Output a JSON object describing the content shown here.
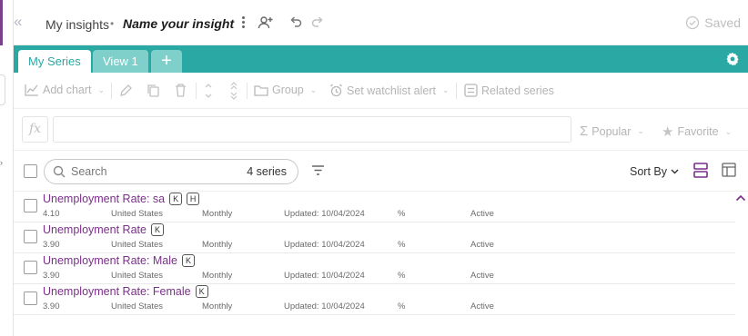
{
  "header": {
    "breadcrumb": "My insights",
    "separator": "•",
    "insight_name": "Name your insight",
    "saved_label": "Saved"
  },
  "tabs": [
    {
      "label": "My Series",
      "active": true
    },
    {
      "label": "View 1",
      "active": false
    },
    {
      "label": "+",
      "active": false
    }
  ],
  "toolbar": {
    "add_chart": "Add chart",
    "group": "Group",
    "watchlist": "Set watchlist alert",
    "related": "Related series"
  },
  "formula": {
    "fx": "fx",
    "popular": "Popular",
    "favorite": "Favorite"
  },
  "search": {
    "placeholder": "Search",
    "count": "4 series",
    "sort_label": "Sort By"
  },
  "series": [
    {
      "title": "Unemployment Rate: sa",
      "tags": [
        "K",
        "H"
      ],
      "value": "4.10",
      "geo": "United States",
      "frequency": "Monthly",
      "updated": "Updated: 10/04/2024",
      "unit": "%",
      "status": "Active"
    },
    {
      "title": "Unemployment Rate",
      "tags": [
        "K"
      ],
      "value": "3.90",
      "geo": "United States",
      "frequency": "Monthly",
      "updated": "Updated: 10/04/2024",
      "unit": "%",
      "status": "Active"
    },
    {
      "title": "Unemployment Rate: Male",
      "tags": [
        "K"
      ],
      "value": "3.90",
      "geo": "United States",
      "frequency": "Monthly",
      "updated": "Updated: 10/04/2024",
      "unit": "%",
      "status": "Active"
    },
    {
      "title": "Unemployment Rate: Female",
      "tags": [
        "K"
      ],
      "value": "3.90",
      "geo": "United States",
      "frequency": "Monthly",
      "updated": "Updated: 10/04/2024",
      "unit": "%",
      "status": "Active"
    }
  ],
  "colors": {
    "accent_teal": "#2aa8a3",
    "series_purple": "#7b2f8a"
  }
}
